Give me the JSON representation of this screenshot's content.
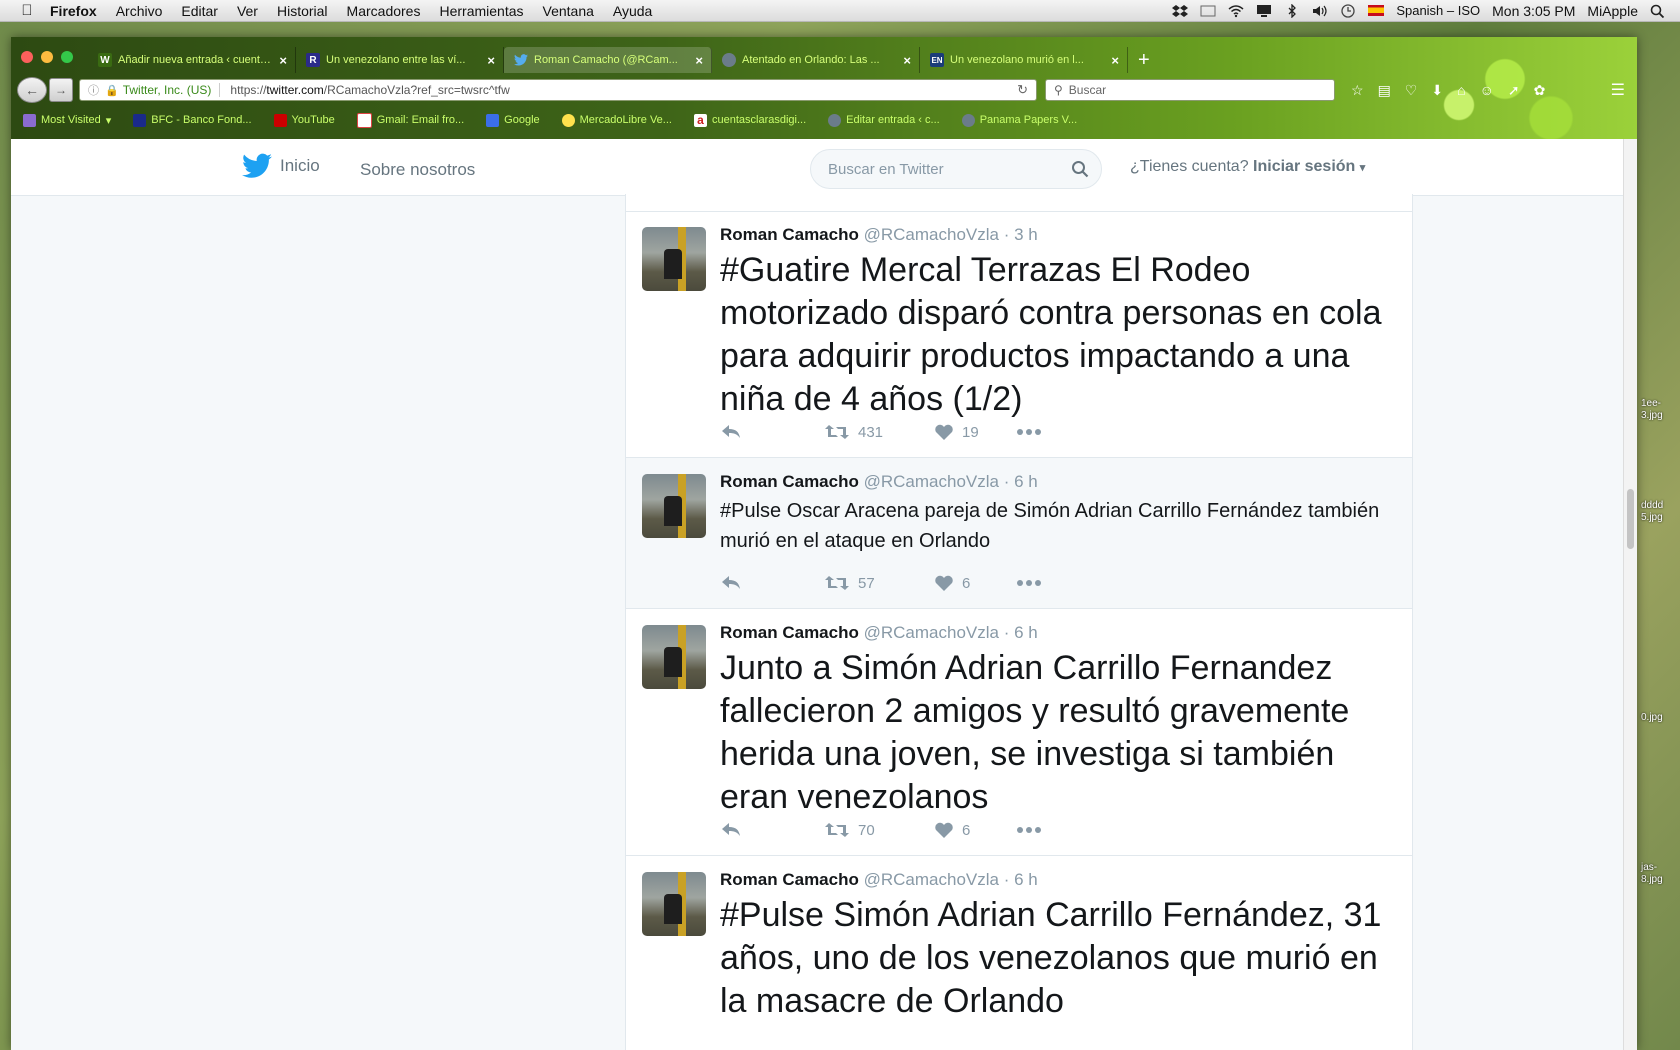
{
  "menubar": {
    "app": "Firefox",
    "items": [
      "Archivo",
      "Editar",
      "Ver",
      "Historial",
      "Marcadores",
      "Herramientas",
      "Ventana",
      "Ayuda"
    ],
    "input_source": "Spanish – ISO",
    "clock": "Mon 3:05 PM",
    "user": "MiApple"
  },
  "browser": {
    "tabs": [
      {
        "label": "Añadir nueva entrada ‹ cuenta...",
        "icon": "wordpress-icon",
        "color": "#3a6b12"
      },
      {
        "label": "Un venezolano entre las ví...",
        "icon": "R",
        "color": "#2b2b8a"
      },
      {
        "label": "Roman Camacho (@RCam...",
        "icon": "twitter-icon",
        "color": "#55acee"
      },
      {
        "label": "Atentado en Orlando: Las ...",
        "icon": "globe-icon",
        "color": "#6b7c8a"
      },
      {
        "label": "Un venezolano murió en l...",
        "icon": "EN",
        "color": "#1b3d7a"
      }
    ],
    "site_identity": "Twitter, Inc. (US)",
    "url_prefix": "https://",
    "url_domain": "twitter.com",
    "url_path": "/RCamachoVzla?ref_src=twsrc^tfw",
    "search_placeholder": "Buscar",
    "bookmarks": [
      {
        "label": "Most Visited",
        "color": "#8a6bd0"
      },
      {
        "label": "BFC - Banco Fond...",
        "color": "#1a2a8a"
      },
      {
        "label": "YouTube",
        "color": "#cc0000"
      },
      {
        "label": "Gmail: Email fro...",
        "color": "#d44"
      },
      {
        "label": "Google",
        "color": "#3b6ee8"
      },
      {
        "label": "MercadoLibre Ve...",
        "color": "#ffe14d"
      },
      {
        "label": "cuentasclarasdigi...",
        "color": "#cc2222"
      },
      {
        "label": "Editar entrada ‹ c...",
        "color": "#6b7c8a"
      },
      {
        "label": "Panama Papers V...",
        "color": "#6b7c8a"
      }
    ]
  },
  "twitter": {
    "home": "Inicio",
    "about": "Sobre nosotros",
    "search_placeholder": "Buscar en Twitter",
    "account_question": "¿Tienes cuenta?",
    "login": "Iniciar sesión",
    "tweets": [
      {
        "name": "Roman Camacho",
        "handle": "@RCamachoVzla",
        "time": "· 3 h",
        "hashtag": "#Guatire",
        "text": " Mercal Terrazas El Rodeo motorizado disparó contra personas en cola para adquirir productos impactando a una niña de 4 años (1/2)",
        "retweets": "431",
        "likes": "19",
        "size": "big"
      },
      {
        "name": "Roman Camacho",
        "handle": "@RCamachoVzla",
        "time": "· 6 h",
        "hashtag": "#Pulse",
        "text": " Oscar Aracena pareja de Simón Adrian Carrillo Fernández también murió en el ataque en Orlando",
        "retweets": "57",
        "likes": "6",
        "size": "small"
      },
      {
        "name": "Roman Camacho",
        "handle": "@RCamachoVzla",
        "time": "· 6 h",
        "hashtag": "",
        "text": "Junto a Simón Adrian Carrillo Fernandez fallecieron 2 amigos y resultó gravemente herida una joven, se investiga si también eran venezolanos",
        "retweets": "70",
        "likes": "6",
        "size": "big"
      },
      {
        "name": "Roman Camacho",
        "handle": "@RCamachoVzla",
        "time": "· 6 h",
        "hashtag": "#Pulse",
        "text": " Simón Adrian Carrillo Fernández, 31 años, uno de los venezolanos que murió en la masacre de Orlando",
        "retweets": "",
        "likes": "",
        "size": "big"
      }
    ]
  },
  "desktop_labels": [
    "1ee-\n3.jpg",
    "dddd\n5.jpg",
    "0.jpg",
    "jas-\n8.jpg"
  ]
}
